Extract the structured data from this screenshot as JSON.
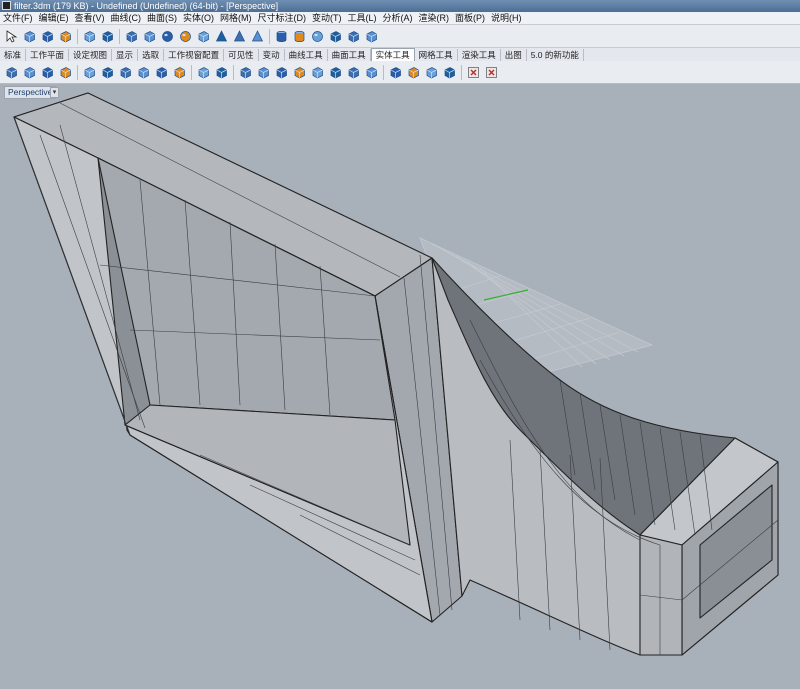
{
  "window": {
    "title": "filter.3dm (179 KB) - Undefined (Undefined) (64-bit) - [Perspective]"
  },
  "menu": {
    "items": [
      "文件(F)",
      "编辑(E)",
      "查看(V)",
      "曲线(C)",
      "曲面(S)",
      "实体(O)",
      "网格(M)",
      "尺寸标注(D)",
      "变动(T)",
      "工具(L)",
      "分析(A)",
      "渲染(R)",
      "面板(P)",
      "说明(H)"
    ]
  },
  "toolbar_tabs": {
    "items": [
      "标准",
      "工作平面",
      "设定视图",
      "显示",
      "选取",
      "工作视窗配置",
      "可见性",
      "变动",
      "曲线工具",
      "曲面工具",
      "实体工具",
      "网格工具",
      "渲染工具",
      "出图",
      "5.0 的新功能"
    ],
    "active": "实体工具"
  },
  "toolbar1_icons": [
    "select-arrow-icon",
    "point-edit-icon",
    "polyline-icon",
    "transform-icon",
    "solid-boolean-icon",
    "explode-icon",
    "box-icon",
    "box-corner-icon",
    "sphere-icon",
    "ellipsoid-icon",
    "paraboloid-icon",
    "cone-icon",
    "pyramid-icon",
    "truncated-cone-icon",
    "cylinder-icon",
    "tube-icon",
    "torus-icon",
    "pipe-icon",
    "extrude-icon",
    "solid-edit-icon"
  ],
  "toolbar2_icons": [
    "boolean-union-icon",
    "boolean-difference-icon",
    "boolean-intersection-icon",
    "boolean-split-icon",
    "cap-icon",
    "solid-shell-icon",
    "fillet-edge-icon",
    "blend-edge-icon",
    "chamfer-icon",
    "move-face-icon",
    "extrude-face-icon",
    "offset-solid-icon",
    "rotate-face-icon",
    "split-face-icon",
    "fold-face-icon",
    "merge-face-icon",
    "move-edge-icon",
    "wire-cut-icon",
    "make-hole-icon",
    "round-hole-icon",
    "array-hole-icon",
    "place-hole-icon",
    "rotate-hole-icon",
    "texture-icon",
    "render-icon",
    "close-panel-icon"
  ],
  "viewport": {
    "label": "Perspective",
    "background": "#a8b0ba"
  }
}
